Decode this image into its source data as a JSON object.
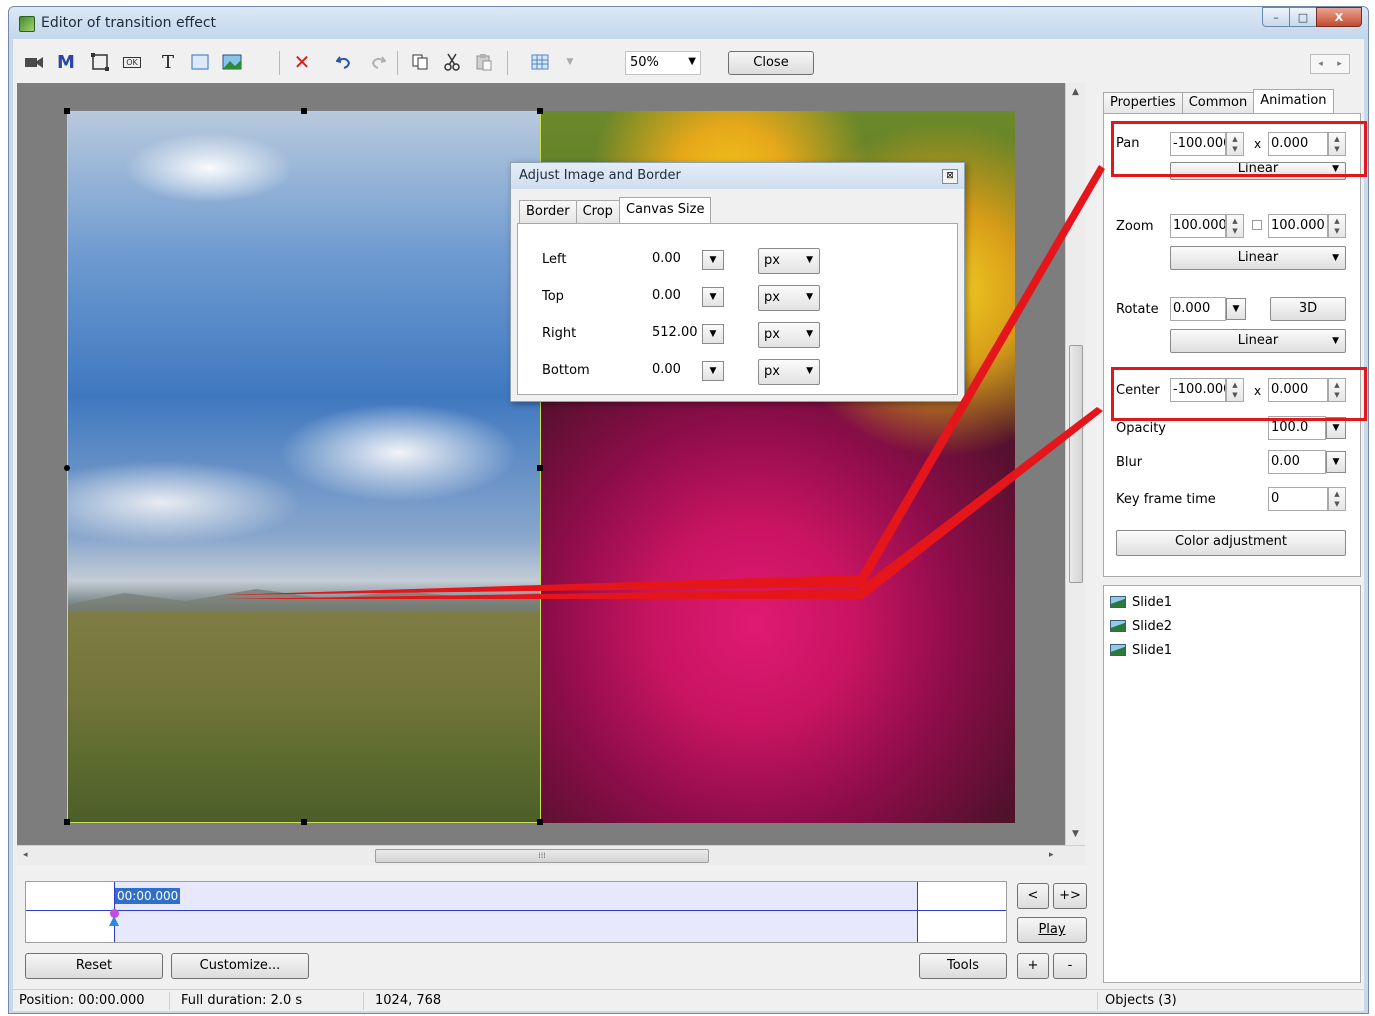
{
  "window": {
    "title": "Editor of transition effect",
    "controls": {
      "minimize": "–",
      "maximize": "□",
      "close": "X"
    }
  },
  "toolbar": {
    "icons": [
      "camera-icon",
      "mask-icon",
      "frame-icon",
      "ok-button-icon",
      "text-icon",
      "rectangle-icon",
      "image-icon",
      "delete-icon",
      "undo-icon",
      "redo-icon",
      "copy-icon",
      "cut-icon",
      "paste-icon",
      "grid-icon"
    ],
    "mask_label": "M",
    "text_label": "T",
    "ok_label": "OK",
    "delete_label": "✕",
    "zoom": "50%",
    "close_label": "Close"
  },
  "dialog": {
    "title": "Adjust Image and Border",
    "tabs": [
      "Border",
      "Crop",
      "Canvas Size"
    ],
    "active_tab": "Canvas Size",
    "rows": [
      {
        "label": "Left",
        "value": "0.00",
        "unit": "px"
      },
      {
        "label": "Top",
        "value": "0.00",
        "unit": "px"
      },
      {
        "label": "Right",
        "value": "512.00",
        "unit": "px"
      },
      {
        "label": "Bottom",
        "value": "0.00",
        "unit": "px"
      }
    ]
  },
  "timeline": {
    "position": "00:00.000"
  },
  "buttons": {
    "reset": "Reset",
    "customize": "Customize...",
    "tools": "Tools",
    "prev": "<",
    "next": "+>",
    "play": "Play",
    "plus": "+",
    "minus": "-"
  },
  "right_panel": {
    "tabs": [
      "Properties",
      "Common",
      "Animation"
    ],
    "active_tab": "Animation",
    "pan": {
      "label": "Pan",
      "x": "-100.000",
      "y": "0.000",
      "mode": "Linear",
      "sep": "x"
    },
    "zoom": {
      "label": "Zoom",
      "x": "100.000",
      "y": "100.000",
      "mode": "Linear"
    },
    "rotate": {
      "label": "Rotate",
      "value": "0.000",
      "btn": "3D",
      "mode": "Linear"
    },
    "center": {
      "label": "Center",
      "x": "-100.000",
      "y": "0.000",
      "sep": "x"
    },
    "opacity": {
      "label": "Opacity",
      "value": "100.0"
    },
    "blur": {
      "label": "Blur",
      "value": "0.00"
    },
    "keyframe": {
      "label": "Key frame time",
      "value": "0"
    },
    "color_btn": "Color adjustment",
    "accent": "#e4161b"
  },
  "objects": [
    {
      "name": "Slide1"
    },
    {
      "name": "Slide2"
    },
    {
      "name": "Slide1"
    }
  ],
  "status": {
    "position": "Position: 00:00.000",
    "duration": "Full duration: 2.0 s",
    "size": "1024, 768",
    "objects": "Objects (3)"
  }
}
